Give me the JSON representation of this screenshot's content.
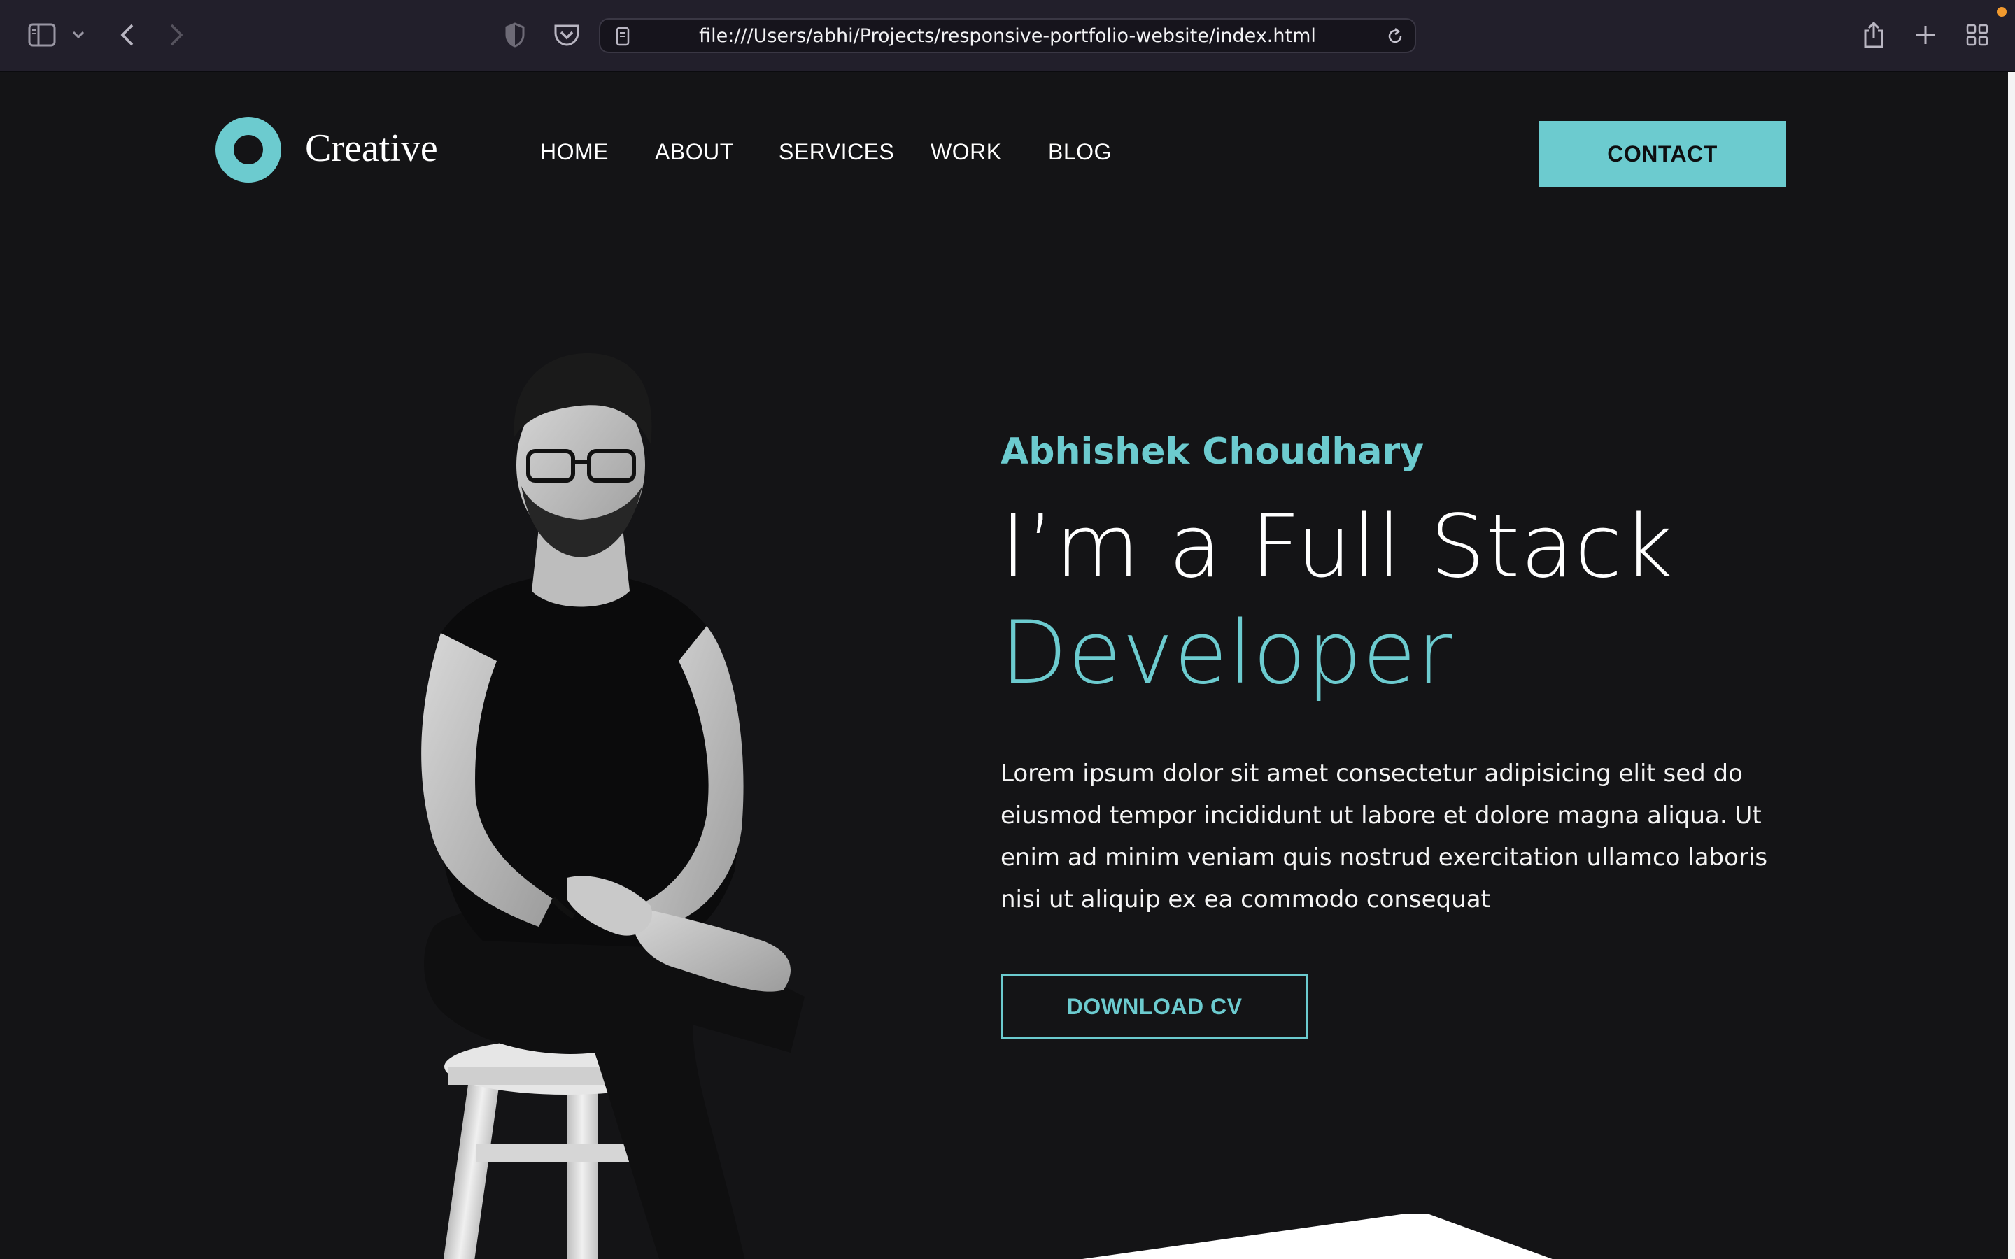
{
  "browser": {
    "url": "file:///Users/abhi/Projects/responsive-portfolio-website/index.html",
    "icons": [
      "sidebar-icon",
      "chevron-down-icon",
      "back-arrow-icon",
      "forward-arrow-icon",
      "shield-icon",
      "pocket-icon",
      "page-icon",
      "reload-icon",
      "share-icon",
      "plus-icon",
      "tab-overview-icon"
    ]
  },
  "header": {
    "brand": "Creative",
    "nav": [
      "HOME",
      "ABOUT",
      "SERVICES",
      "WORK",
      "BLOG"
    ],
    "contact_label": "CONTACT"
  },
  "hero": {
    "name": "Abhishek Choudhary",
    "title_line1": "I’m a Full Stack",
    "title_line2": "Developer",
    "description": "Lorem ipsum dolor sit amet consectetur adipisicing elit sed do eiusmod tempor incididunt ut labore et dolore magna aliqua. Ut enim ad minim veniam quis nostrud exercitation ullamco laboris nisi ut aliquip ex ea commodo consequat",
    "cta_label": "DOWNLOAD CV"
  },
  "colors": {
    "accent": "#6ccbcf",
    "background": "#141416",
    "chrome": "#221f2b",
    "text": "#ffffff"
  }
}
